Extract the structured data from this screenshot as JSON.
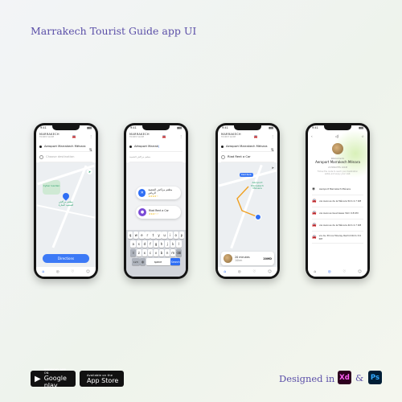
{
  "page_title": "Marrakech Tourist Guide app UI",
  "footer": {
    "designed_in": "Designed in",
    "xd": "Xd",
    "amp": "&",
    "ps": "Ps",
    "google_play_small": "ANDROID APP ON",
    "google_play_big": "Google play",
    "app_store_small": "Available on the",
    "app_store_big": "App Store"
  },
  "colors": {
    "accent": "#3c79f6",
    "brand_title": "#5b4fa8",
    "park": "#cfe9d4"
  },
  "status": {
    "time": "9:41",
    "signal": "▮▮▮"
  },
  "app": {
    "brand": "MARRAKECH",
    "brand_sub": "TOURIST GUIDE"
  },
  "screen1": {
    "origin": "Aeroport Marrakech Ménara",
    "destination": "Choose destination",
    "map_label": "Cyber Garden",
    "pin_label": "مطعم مراكش الشعبية المنارة",
    "cta": "Directions"
  },
  "screen2": {
    "origin": "Aéroport Marrak",
    "suggestion_sub": "مطعم مراكش الشعبية",
    "suggestion1_title": "مطعم مراكش الشعبية الرياض",
    "suggestion1_stars": "★★★★☆",
    "suggestion2_title": "Riad Rent a Car",
    "suggestion2_stars": "★★★☆☆",
    "keyboard": {
      "row1": [
        "q",
        "w",
        "e",
        "r",
        "t",
        "y",
        "u",
        "i",
        "o",
        "p"
      ],
      "row2": [
        "a",
        "s",
        "d",
        "f",
        "g",
        "h",
        "j",
        "k",
        "l"
      ],
      "row3": [
        "z",
        "x",
        "c",
        "v",
        "b",
        "n",
        "m"
      ],
      "space": "space",
      "go": "Search",
      "num": "123"
    }
  },
  "screen3": {
    "origin": "Aeroport Marrakech Ménara",
    "destination": "Riad Rent a Car",
    "map_tag": "Riad Rent",
    "map_label": "Aéroport Marrakech Ménara",
    "card_time": "20 minutes",
    "card_dist": "10km",
    "card_price": "20MD"
  },
  "screen4": {
    "welcome": "Welcome to",
    "place": "Aeroport Marrakech Ménara",
    "eta": "20 MINUTES 10KM",
    "desc": "Follow the route to reach your destination safely and enjoy your visit.",
    "steps": [
      "Aeroport Marrakech Ménara",
      "via Avenue de la Ménara  5km  2.7 KM",
      "via Avenue Guemassa  3km  0.8 KM",
      "via Avenue de la Ménara  4km  2.7 KM",
      "via Av. Prince Moulay Rachid  6km  3.6 KM"
    ]
  }
}
